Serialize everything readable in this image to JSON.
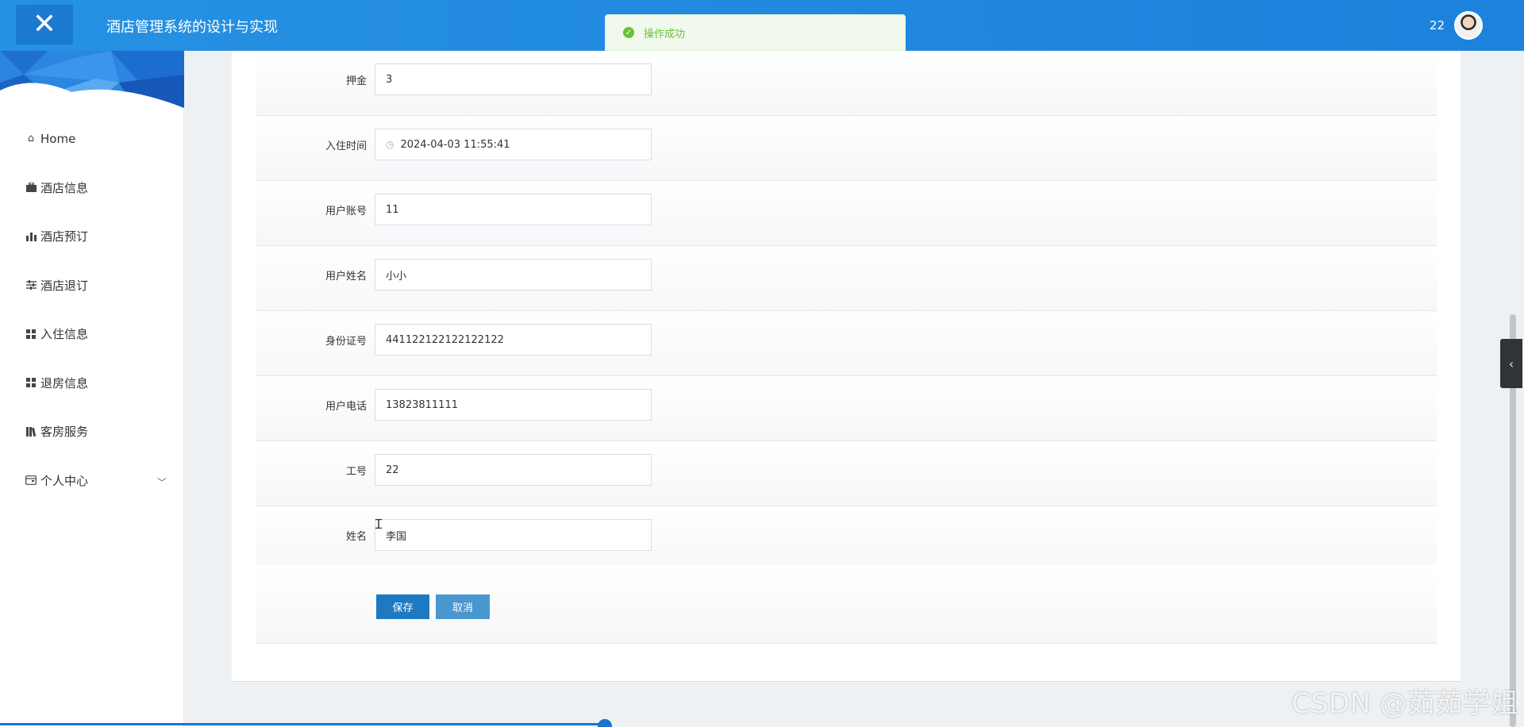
{
  "header": {
    "close_icon": "close-icon",
    "title": "酒店管理系统的设计与实现",
    "user_label": "22"
  },
  "toast": {
    "message": "操作成功",
    "color": "#67c23a"
  },
  "sidebar": {
    "items": [
      {
        "label": "Home",
        "icon": "home-icon"
      },
      {
        "label": "酒店信息",
        "icon": "briefcase-icon"
      },
      {
        "label": "酒店预订",
        "icon": "bar-chart-icon"
      },
      {
        "label": "酒店退订",
        "icon": "sliders-icon"
      },
      {
        "label": "入住信息",
        "icon": "grid-icon"
      },
      {
        "label": "退房信息",
        "icon": "grid-icon"
      },
      {
        "label": "客房服务",
        "icon": "book-icon"
      },
      {
        "label": "个人中心",
        "icon": "wallet-icon"
      }
    ]
  },
  "form": {
    "rows": [
      {
        "label": "押金",
        "value": "3"
      },
      {
        "label": "入住时间",
        "value": "2024-04-03 11:55:41"
      },
      {
        "label": "用户账号",
        "value": "11"
      },
      {
        "label": "用户姓名",
        "value": "小小"
      },
      {
        "label": "身份证号",
        "value": "441122122122122122"
      },
      {
        "label": "用户电话",
        "value": "13823811111"
      },
      {
        "label": "工号",
        "value": "22"
      },
      {
        "label": "姓名",
        "value": "李国"
      }
    ],
    "save_label": "保存",
    "cancel_label": "取消"
  },
  "colors": {
    "header_blue": "#1c82dc",
    "save_button": "#1d79c2",
    "cancel_button": "#4a96cf"
  },
  "watermark": "CSDN @茹茹学姐"
}
